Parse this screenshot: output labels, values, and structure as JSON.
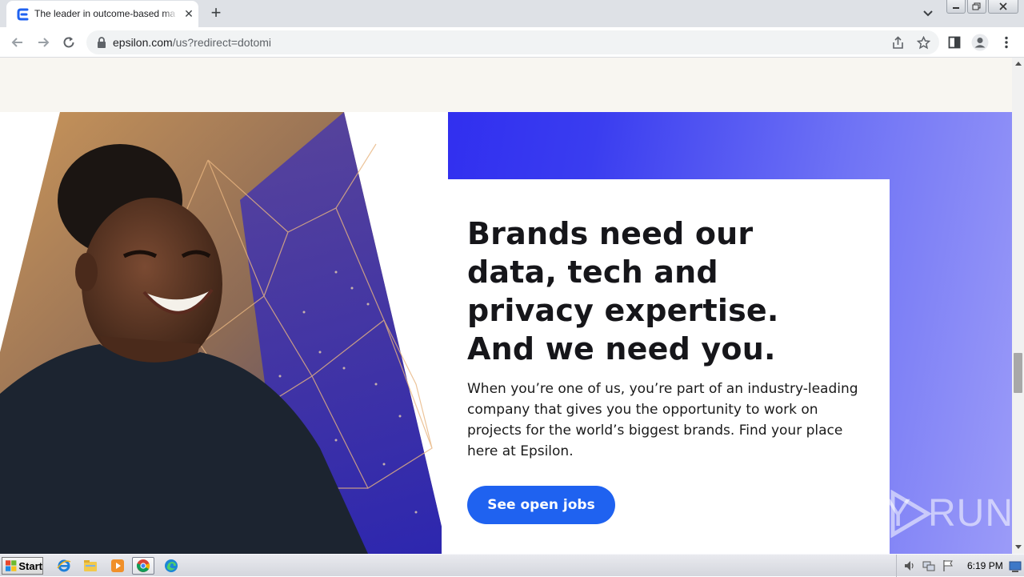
{
  "browser": {
    "tab_title": "The leader in outcome-based marketing",
    "tab_close": "✕",
    "new_tab": "+",
    "url_host": "epsilon.com",
    "url_path": "/us?redirect=dotomi"
  },
  "hero": {
    "heading": "Brands need our data, tech and privacy expertise. And we need you.",
    "body": "When you’re one of us, you’re part of an industry-leading company that gives you the opportunity to work on projects for the world’s biggest brands. Find your place here at Epsilon.",
    "cta_label": "See open jobs"
  },
  "watermark": {
    "text_left": "ANY",
    "text_right": "RUN"
  },
  "taskbar": {
    "start_label": "Start",
    "clock": "6:19 PM",
    "apps": [
      "ie-icon",
      "explorer-icon",
      "media-player-icon",
      "chrome-icon",
      "edge-icon"
    ]
  },
  "colors": {
    "brand_blue": "#1f62f0",
    "hero_blue": "#2c25ec",
    "cream": "#f8f6f1"
  }
}
